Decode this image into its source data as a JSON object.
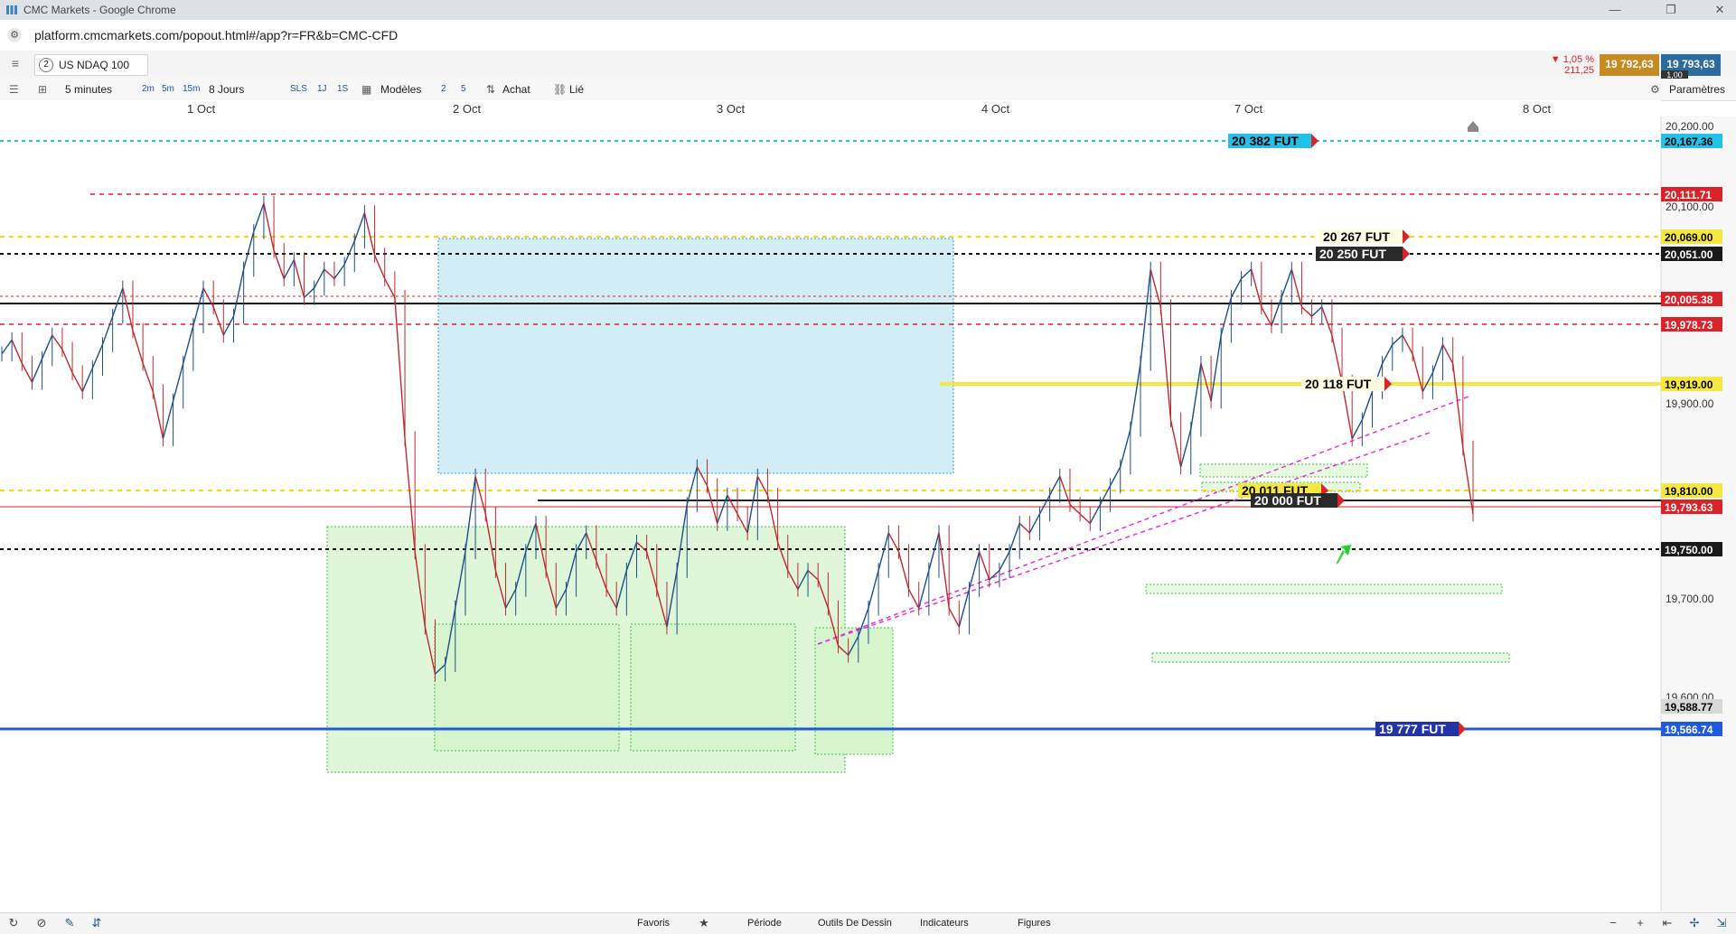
{
  "window": {
    "title": "CMC Markets - Google Chrome",
    "minimize_glyph": "—",
    "restore_glyph": "❐",
    "close_glyph": "✕"
  },
  "browser": {
    "url": "platform.cmcmarkets.com/popout.html#/app?r=FR&b=CMC-CFD"
  },
  "header": {
    "instrument_number": "2",
    "instrument_name": "US NDAQ 100",
    "change_pct": "▼ 1,05 %",
    "change_pts": "211,25",
    "bid": "19 792,63",
    "ask": "19 793,63",
    "spread": "1,00"
  },
  "toolbar": {
    "timeframe": "5 minutes",
    "tf_2m": "2m",
    "tf_5m": "5m",
    "tf_15m": "15m",
    "period": "8 Jours",
    "sls": "SLS",
    "p1j": "1J",
    "p1s": "1S",
    "templates": "Modèles",
    "n2": "2",
    "n5": "5",
    "buy": "Achat",
    "linked": "Lié",
    "settings": "Paramètres"
  },
  "dates": [
    "1 Oct",
    "2 Oct",
    "3 Oct",
    "4 Oct",
    "7 Oct",
    "8 Oct"
  ],
  "colors": {
    "up": "#1b4f8a",
    "down": "#c0282e",
    "current": "#c0282e",
    "blue_line": "#1f5bd8"
  },
  "chart_data": {
    "type": "line",
    "instrument": "US NDAQ 100",
    "timeframe": "5 minutes",
    "x_labels": [
      "1 Oct",
      "2 Oct",
      "3 Oct",
      "4 Oct",
      "7 Oct",
      "8 Oct"
    ],
    "ylim": [
      19560,
      20230
    ],
    "y_ticks": [
      "20,200.00",
      "20,100.00",
      "19,900.00",
      "19,700.00",
      "19,600.00"
    ],
    "price_tags": [
      {
        "label": "20,167.36",
        "color": "#23c0e8",
        "text_color": "#000"
      },
      {
        "label": "20,111.71",
        "color": "#d9232a",
        "text_color": "#fff"
      },
      {
        "label": "20,069.00",
        "color": "#f5e642",
        "text_color": "#000"
      },
      {
        "label": "20,051.00",
        "color": "#1a1a1a",
        "text_color": "#fff"
      },
      {
        "label": "20,005.38",
        "color": "#d9232a",
        "text_color": "#fff"
      },
      {
        "label": "19,978.73",
        "color": "#d9232a",
        "text_color": "#fff"
      },
      {
        "label": "19,919.00",
        "color": "#f5e642",
        "text_color": "#000"
      },
      {
        "label": "19,810.00",
        "color": "#f5e642",
        "text_color": "#000"
      },
      {
        "label": "19,793.63",
        "color": "#d9232a",
        "text_color": "#fff"
      },
      {
        "label": "19,750.00",
        "color": "#1a1a1a",
        "text_color": "#fff"
      },
      {
        "label": "19,588.77",
        "color": "#d8d8d8",
        "text_color": "#000"
      },
      {
        "label": "19,566.74",
        "color": "#1f5bd8",
        "text_color": "#fff"
      }
    ],
    "futures_labels": [
      "20 382 FUT",
      "20 267 FUT",
      "20 250 FUT",
      "20 118 FUT",
      "20 011 FUT",
      "20 000 FUT",
      "19 777 FUT"
    ],
    "series": [
      {
        "values": [
          19970,
          19985,
          19960,
          19940,
          19965,
          19990,
          19975,
          19950,
          19930,
          19955,
          19980,
          20010,
          20040,
          19995,
          19960,
          19930,
          19880,
          19920,
          19960,
          20000,
          20040,
          20020,
          19990,
          20010,
          20060,
          20100,
          20130,
          20080,
          20050,
          20070,
          20030,
          20040,
          20060,
          20050,
          20065,
          20090,
          20120,
          20075,
          20050,
          20030,
          19880,
          19760,
          19680,
          19630,
          19640,
          19700,
          19760,
          19840,
          19800,
          19740,
          19700,
          19720,
          19760,
          19790,
          19740,
          19700,
          19720,
          19760,
          19780,
          19750,
          19720,
          19700,
          19740,
          19770,
          19760,
          19720,
          19680,
          19740,
          19810,
          19850,
          19830,
          19790,
          19820,
          19800,
          19780,
          19840,
          19820,
          19770,
          19740,
          19720,
          19740,
          19730,
          19700,
          19660,
          19650,
          19670,
          19700,
          19740,
          19780,
          19760,
          19720,
          19700,
          19740,
          19780,
          19700,
          19680,
          19720,
          19760,
          19730,
          19740,
          19760,
          19790,
          19780,
          19800,
          19820,
          19840,
          19810,
          19800,
          19790,
          19810,
          19830,
          19850,
          19890,
          19960,
          20060,
          20020,
          19900,
          19850,
          19890,
          19960,
          19920,
          19990,
          20030,
          20050,
          20060,
          20020,
          20000,
          20030,
          20060,
          20020,
          20010,
          20020,
          19990,
          19940,
          19880,
          19900,
          19930,
          19960,
          19980,
          19990,
          19970,
          19930,
          19950,
          19980,
          19960,
          19870,
          19800
        ]
      }
    ]
  },
  "bottombar": {
    "favorites": "Favoris",
    "period": "Période",
    "drawing_tools": "Outils De Dessin",
    "indicators": "Indicateurs",
    "shapes": "Figures"
  }
}
